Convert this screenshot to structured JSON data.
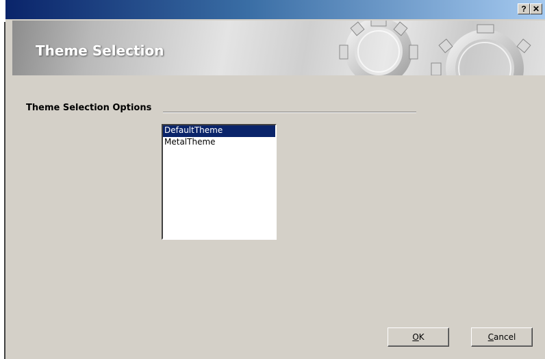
{
  "titlebar": {
    "help_label": "?",
    "close_label": "✕"
  },
  "banner": {
    "title": "Theme Selection",
    "image_icon": "gears-icon"
  },
  "section": {
    "label": "Theme Selection Options"
  },
  "theme_list": {
    "items": [
      "DefaultTheme",
      "MetalTheme"
    ],
    "selected": "DefaultTheme"
  },
  "buttons": {
    "ok_mnemonic": "O",
    "ok_rest": "K",
    "cancel_mnemonic": "C",
    "cancel_rest": "ancel"
  },
  "colors": {
    "titlebar_start": "#0a246a",
    "titlebar_end": "#a6caf0",
    "selection": "#0a246a",
    "dialog_face": "#d4d0c8"
  }
}
